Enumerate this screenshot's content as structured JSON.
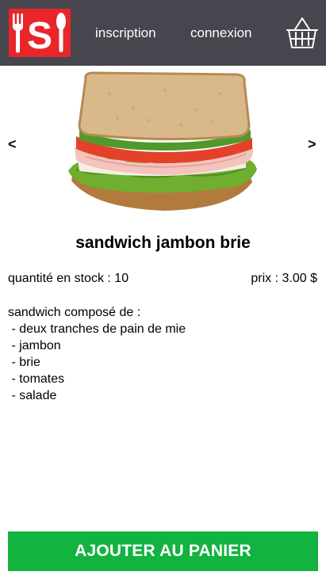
{
  "header": {
    "logo_icon": "fork-s-spoon-logo-icon",
    "nav": {
      "inscription": "inscription",
      "connexion": "connexion"
    },
    "cart_icon": "basket-icon"
  },
  "colors": {
    "header_bg": "#47454d",
    "logo_red": "#e8262a",
    "button_green": "#12b33f"
  },
  "carousel": {
    "prev_label": "<",
    "next_label": ">",
    "image": "sandwich-image"
  },
  "product": {
    "name": "sandwich jambon brie",
    "stock": "quantité en stock : 10",
    "price": "prix : 3.00 $",
    "description": [
      "sandwich composé de :",
      " - deux tranches de pain de mie",
      " - jambon",
      " - brie",
      " - tomates",
      " - salade"
    ]
  },
  "actions": {
    "add_to_cart": "AJOUTER AU PANIER"
  }
}
